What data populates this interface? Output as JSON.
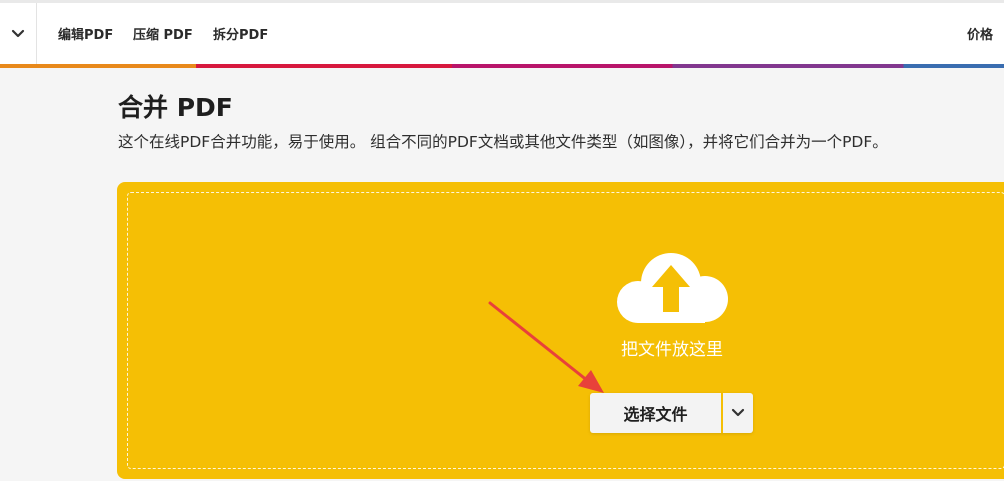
{
  "nav": {
    "menu_icon": "chevron-down-icon",
    "links": [
      "编辑PDF",
      "压缩 PDF",
      "拆分PDF"
    ],
    "pricing": "价格"
  },
  "colors": {
    "brand_stripe": [
      "#e8891b",
      "#d7183e",
      "#b8156a",
      "#82378f",
      "#3a6db0"
    ],
    "dropzone": "#f5bf05",
    "annotation_arrow": "#e8413a"
  },
  "main": {
    "title": "合并 PDF",
    "description": "这个在线PDF合并功能，易于使用。 组合不同的PDF文档或其他文件类型（如图像），并将它们合并为一个PDF。"
  },
  "dropzone": {
    "icon": "cloud-upload-icon",
    "hint": "把文件放这里",
    "select_button": "选择文件",
    "dropdown_icon": "chevron-down-icon"
  },
  "annotation": {
    "icon": "red-arrow-icon"
  }
}
